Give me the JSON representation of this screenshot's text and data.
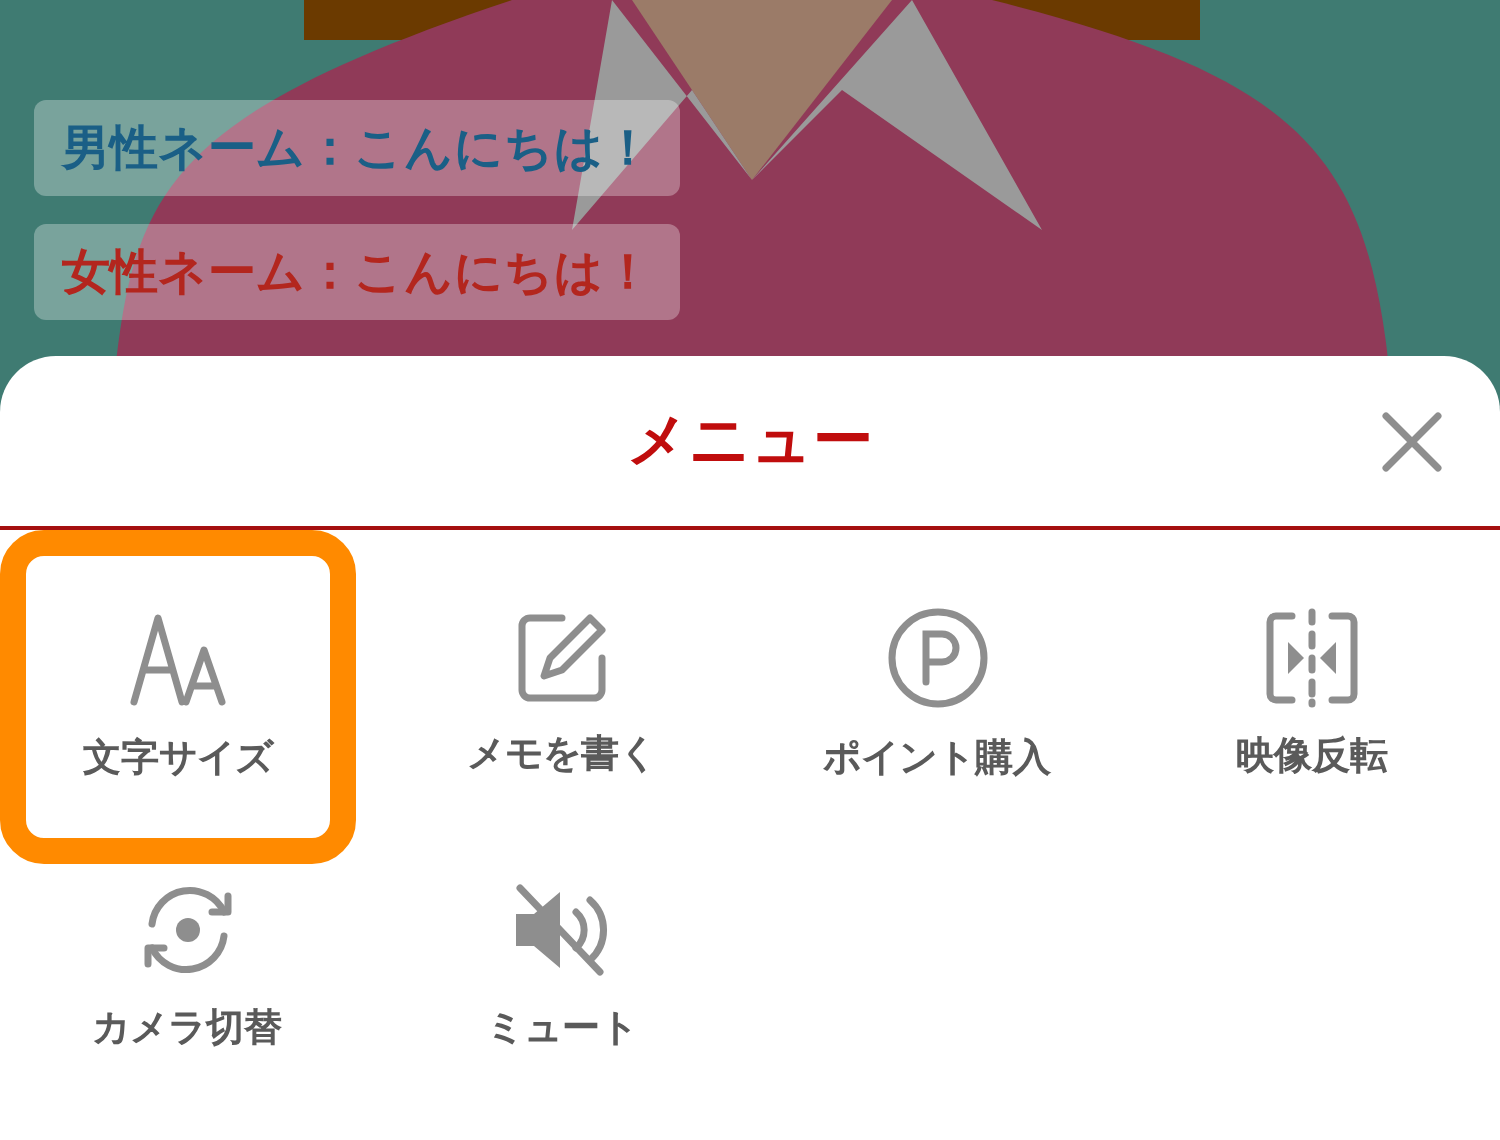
{
  "captions": [
    {
      "text": "男性ネーム：こんにちは！",
      "color": "#1a5f86"
    },
    {
      "text": "女性ネーム：こんにちは！",
      "color": "#b3261e"
    }
  ],
  "menu": {
    "title": "メニュー",
    "items": [
      {
        "label": "文字サイズ",
        "selected": true
      },
      {
        "label": "メモを書く",
        "selected": false
      },
      {
        "label": "ポイント購入",
        "selected": false
      },
      {
        "label": "映像反転",
        "selected": false
      },
      {
        "label": "カメラ切替",
        "selected": false
      },
      {
        "label": "ミュート",
        "selected": false
      }
    ]
  }
}
